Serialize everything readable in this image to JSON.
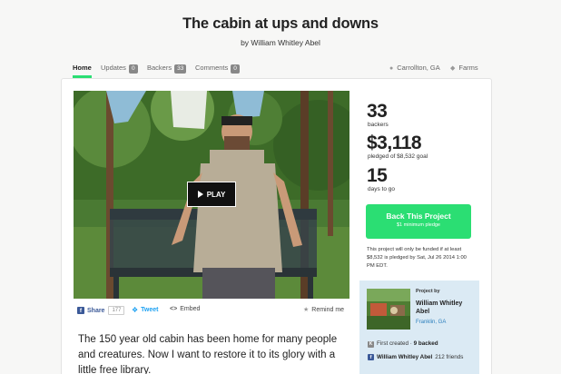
{
  "project": {
    "title": "The cabin at ups and downs",
    "byline": "by William Whitley Abel"
  },
  "nav": {
    "home": "Home",
    "updates": "Updates",
    "updates_count": "0",
    "backers": "Backers",
    "backers_count": "33",
    "comments": "Comments",
    "comments_count": "0",
    "location": "Carrollton, GA",
    "category": "Farms"
  },
  "video": {
    "play_label": "PLAY"
  },
  "share": {
    "facebook_label": "Share",
    "facebook_count": "177",
    "tweet_label": "Tweet",
    "embed_label": "Embed",
    "remind_label": "Remind me"
  },
  "description": "The 150 year old cabin has been home for many people and creatures. Now I want to restore it to its glory with a little free library.",
  "stats": {
    "backers_value": "33",
    "backers_label": "backers",
    "pledged_value": "$3,118",
    "pledged_label": "pledged of $8,532 goal",
    "days_value": "15",
    "days_label": "days to go"
  },
  "back_button": {
    "label": "Back This Project",
    "sub": "$1 minimum pledge"
  },
  "funding_notice": "This project will only be funded if at least $8,532 is pledged by Sat, Jul 26 2014 1:00 PM EDT.",
  "creator": {
    "project_by": "Project by",
    "name": "William Whitley Abel",
    "location": "Franklin, GA",
    "first_created": "First created",
    "backed": "9 backed",
    "fb_name": "William Whitley Abel",
    "fb_friends": "212 friends"
  },
  "colors": {
    "accent_green": "#2bde73",
    "facebook_blue": "#3b5998",
    "twitter_blue": "#1da1f2",
    "creator_panel": "#dbeaf4"
  }
}
